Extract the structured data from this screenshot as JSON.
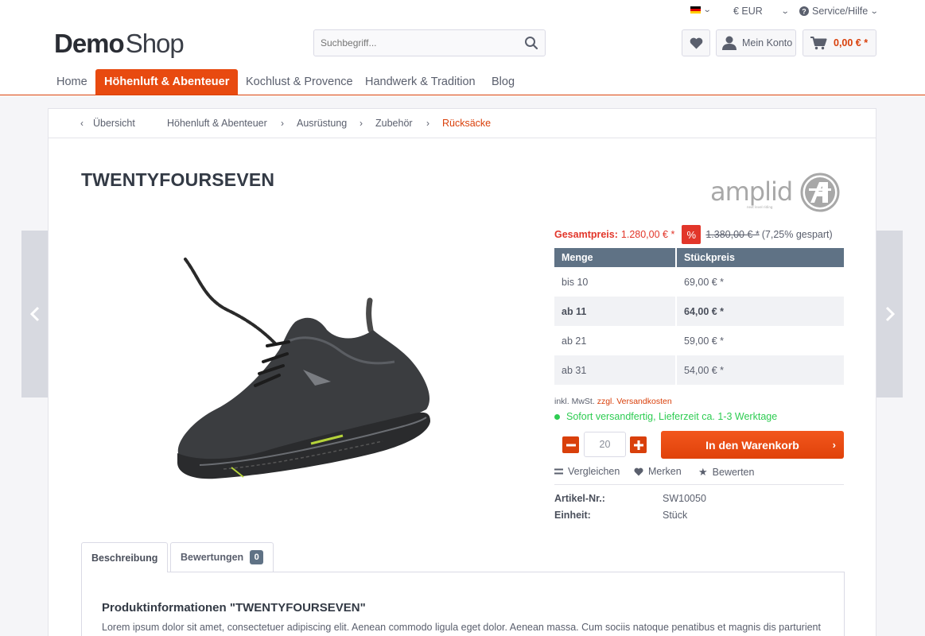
{
  "topbar": {
    "language_flag": "de-flag-icon",
    "currency": "€ EUR",
    "service": "Service/Hilfe"
  },
  "header": {
    "logo_bold": "Demo",
    "logo_light": "Shop",
    "search_placeholder": "Suchbegriff...",
    "account_label": "Mein Konto",
    "cart_total": "0,00 € *"
  },
  "nav": {
    "items": [
      {
        "label": "Home"
      },
      {
        "label": "Höhenluft & Abenteuer"
      },
      {
        "label": "Kochlust & Provence"
      },
      {
        "label": "Handwerk & Tradition"
      },
      {
        "label": "Blog"
      }
    ],
    "active": "Höhenluft & Abenteuer"
  },
  "breadcrumb": {
    "back": "Übersicht",
    "items": [
      "Höhenluft & Abenteuer",
      "Ausrüstung",
      "Zubehör",
      "Rücksäcke"
    ]
  },
  "product": {
    "title": "TWENTYFOURSEVEN",
    "brand": "amplid",
    "brand_tagline": "next level riding",
    "price_label": "Gesamtpreis:",
    "price": "1.280,00 € *",
    "discount_icon": "%",
    "old_price": "1.380,00 € *",
    "saving": "(7,25% gespart)",
    "table_headers": [
      "Menge",
      "Stückpreis"
    ],
    "tiers": [
      {
        "qty": "bis 10",
        "price": "69,00 € *"
      },
      {
        "qty": "ab 11",
        "price": "64,00 € *"
      },
      {
        "qty": "ab 21",
        "price": "59,00 € *"
      },
      {
        "qty": "ab 31",
        "price": "54,00 € *"
      }
    ],
    "tax_note": "inkl. MwSt.",
    "shipping_link": "zzgl. Versandkosten",
    "delivery": "Sofort versandfertig, Lieferzeit ca. 1-3 Werktage",
    "quantity": "20",
    "add_to_cart": "In den Warenkorb",
    "actions": {
      "compare": "Vergleichen",
      "remember": "Merken",
      "rate": "Bewerten"
    },
    "meta": [
      {
        "key": "Artikel-Nr.:",
        "value": "SW10050"
      },
      {
        "key": "Einheit:",
        "value": "Stück"
      }
    ]
  },
  "tabs": {
    "description": "Beschreibung",
    "reviews": "Bewertungen",
    "reviews_count": "0"
  },
  "description": {
    "heading": "Produktinformationen \"TWENTYFOURSEVEN\"",
    "text": "Lorem ipsum dolor sit amet, consectetuer adipiscing elit. Aenean commodo ligula eget dolor. Aenean massa. Cum sociis natoque penatibus et magnis dis parturient"
  },
  "colors": {
    "accent": "#e84a10",
    "sale": "#e2362a",
    "delivery": "#2ecc52",
    "table_header": "#5f7285"
  }
}
